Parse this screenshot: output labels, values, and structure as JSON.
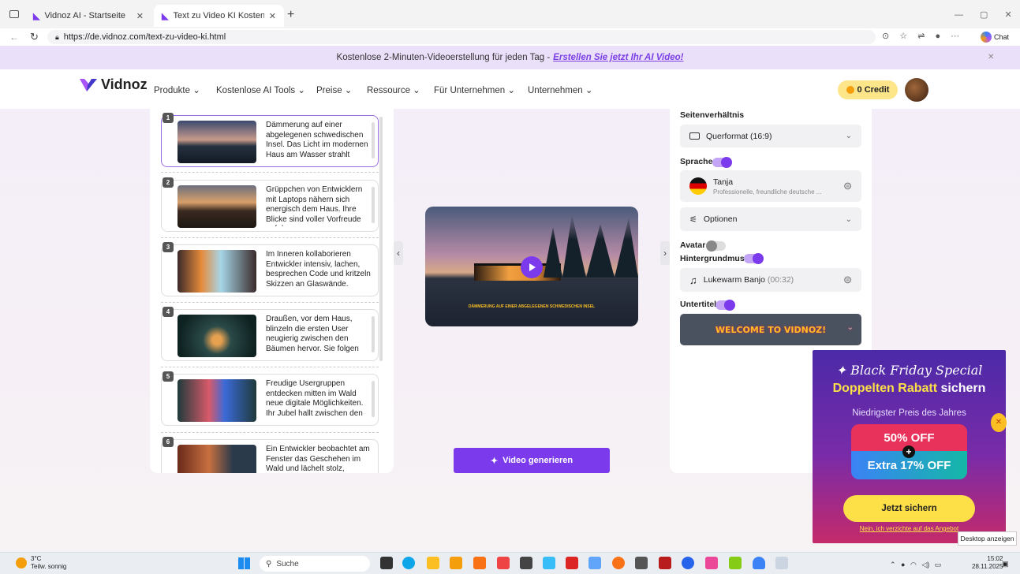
{
  "browser": {
    "tabs": [
      {
        "title": "Vidnoz AI - Startseite"
      },
      {
        "title": "Text zu Video KI Kostenlos: Text in"
      }
    ],
    "url": "https://de.vidnoz.com/text-zu-video-ki.html",
    "chat_label": "Chat"
  },
  "banner": {
    "text": "Kostenlose 2-Minuten-Videoerstellung für jeden Tag -",
    "link": "Erstellen Sie jetzt Ihr AI Video!"
  },
  "nav": {
    "logo": "Vidnoz",
    "items": [
      "Produkte",
      "Kostenlose AI Tools",
      "Preise",
      "Ressource",
      "Für Unternehmen",
      "Unternehmen"
    ],
    "credit": "0 Credit"
  },
  "scenes": [
    {
      "num": "1",
      "text": "Dämmerung auf einer abgelegenen schwedischen Insel. Das Licht im modernen Haus am Wasser strahlt"
    },
    {
      "num": "2",
      "text": "Grüppchen von Entwicklern mit Laptops nähern sich energisch dem Haus. Ihre Blicke sind voller Vorfreude auf das"
    },
    {
      "num": "3",
      "text": "Im Inneren kollaborieren Entwickler intensiv, lachen, besprechen Code und kritzeln Skizzen an Glaswände."
    },
    {
      "num": "4",
      "text": "Draußen, vor dem Haus, blinzeln die ersten User neugierig zwischen den Bäumen hervor. Sie folgen"
    },
    {
      "num": "5",
      "text": "Freudige Usergruppen entdecken mitten im Wald neue digitale Möglichkeiten. Ihr Jubel hallt zwischen den"
    },
    {
      "num": "6",
      "text": "Ein Entwickler beobachtet am Fenster das Geschehen im Wald und lächelt stolz, während das"
    }
  ],
  "video": {
    "caption": "DÄMMERUNG AUF EINER ABGELEGENEN SCHWEDISCHEN INSEL",
    "generate": "Video generieren"
  },
  "settings": {
    "aspect_label": "Seitenverhältnis",
    "aspect_value": "Querformat (16:9)",
    "language_label": "Sprache",
    "voice_name": "Tanja",
    "voice_desc": "Professionelle, freundliche deutsche ...",
    "options": "Optionen",
    "avatar_label": "Avatar",
    "music_label": "Hintergrundmusik",
    "music_name": "Lukewarm Banjo",
    "music_dur": "(00:32)",
    "subtitle_label": "Untertitel",
    "subtitle_preview": "WELCOME TO VIDNOZ!",
    "toggles": {
      "sprache": true,
      "avatar": false,
      "music": true,
      "subtitle": true
    }
  },
  "promo": {
    "title": "Black Friday Special",
    "sub1": "Doppelten Rabatt ",
    "sub2": "sichern",
    "low": "Niedrigster Preis des Jahres",
    "off1": "50% OFF",
    "off2": "Extra 17% OFF",
    "btn": "Jetzt sichern",
    "no": "Nein, ich verzichte auf das Angebot"
  },
  "tooltip": "Desktop anzeigen",
  "taskbar": {
    "temp": "3°C",
    "weather": "Teilw. sonnig",
    "search": "Suche",
    "time": "15:02",
    "date": "28.11.2025"
  },
  "colors": {
    "accent": "#7c3aed",
    "banner": "#ebe0fa",
    "credit": "#fde68a"
  }
}
